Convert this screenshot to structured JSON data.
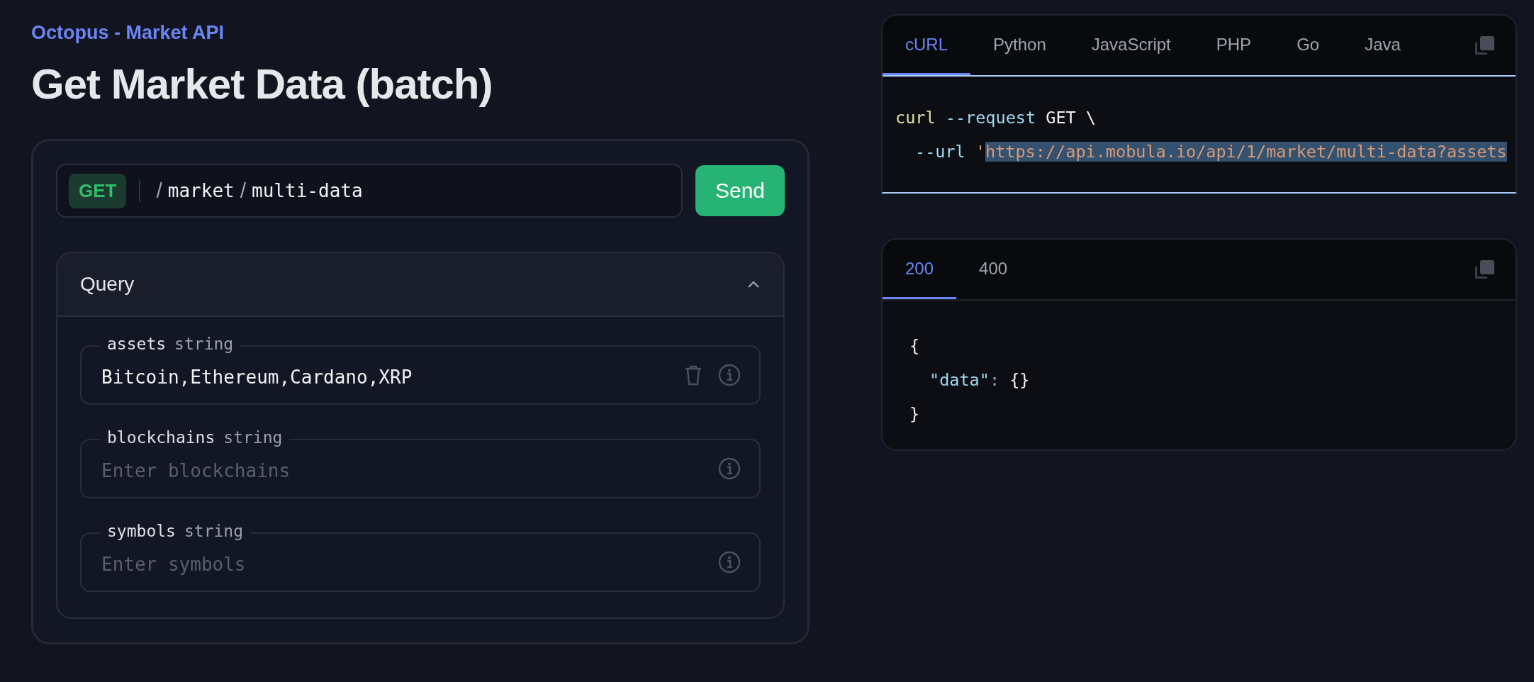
{
  "breadcrumb": "Octopus - Market API",
  "title": "Get Market Data (batch)",
  "request": {
    "method": "GET",
    "path": [
      {
        "separator": "/",
        "segment": "market"
      },
      {
        "separator": "/",
        "segment": "multi-data"
      }
    ],
    "send_label": "Send"
  },
  "query": {
    "title": "Query",
    "expanded": true,
    "fields": [
      {
        "name": "assets",
        "type": "string",
        "value": "Bitcoin,Ethereum,Cardano,XRP",
        "clearable": true
      },
      {
        "name": "blockchains",
        "type": "string",
        "placeholder": "Enter blockchains",
        "clearable": false
      },
      {
        "name": "symbols",
        "type": "string",
        "placeholder": "Enter symbols",
        "clearable": false
      }
    ]
  },
  "code_sample": {
    "tabs": [
      {
        "label": "cURL",
        "selected": true
      },
      {
        "label": "Python",
        "selected": false
      },
      {
        "label": "JavaScript",
        "selected": false
      },
      {
        "label": "PHP",
        "selected": false
      },
      {
        "label": "Go",
        "selected": false
      },
      {
        "label": "Java",
        "selected": false
      }
    ],
    "lines": [
      {
        "tokens": [
          {
            "text": "curl",
            "kind": "command"
          },
          {
            "text": "--request",
            "kind": "flag"
          },
          {
            "text": "GET \\",
            "kind": "plain"
          }
        ],
        "children": [
          {
            "tokens": [
              {
                "text": "--url",
                "kind": "flag"
              },
              {
                "text": "'",
                "kind": "quote"
              },
              {
                "text": "https://api.mobula.io/api/1/market/multi-data?assets",
                "kind": "string",
                "selected": true
              }
            ]
          }
        ]
      }
    ]
  },
  "response": {
    "tabs": [
      {
        "label": "200",
        "selected": true
      },
      {
        "label": "400",
        "selected": false
      }
    ],
    "lines": [
      {
        "tokens": [
          {
            "text": "{",
            "kind": "plain"
          }
        ],
        "children": [
          {
            "tokens": [
              {
                "text": "\"data\"",
                "kind": "key"
              },
              {
                "text": ":",
                "kind": "punct"
              },
              {
                "text": "{}",
                "kind": "plain"
              }
            ]
          }
        ]
      },
      {
        "tokens": [
          {
            "text": "}",
            "kind": "plain"
          }
        ]
      }
    ]
  }
}
